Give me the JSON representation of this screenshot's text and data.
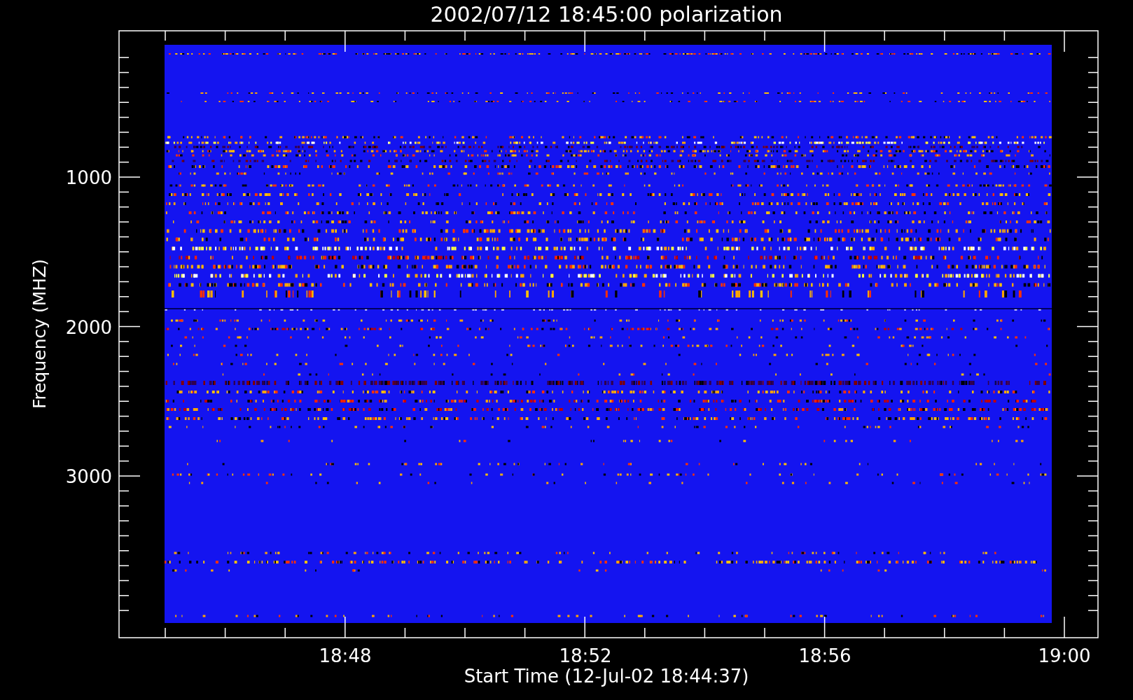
{
  "title": "2002/07/12 18:45:00 polarization",
  "y_axis": {
    "label": "Frequency (MHZ)",
    "tick_labels": [
      "1000",
      "2000",
      "3000"
    ]
  },
  "x_axis": {
    "label": "Start Time (12-Jul-02 18:44:37)",
    "tick_labels": [
      "18:48",
      "18:52",
      "18:56",
      "19:00"
    ]
  }
}
